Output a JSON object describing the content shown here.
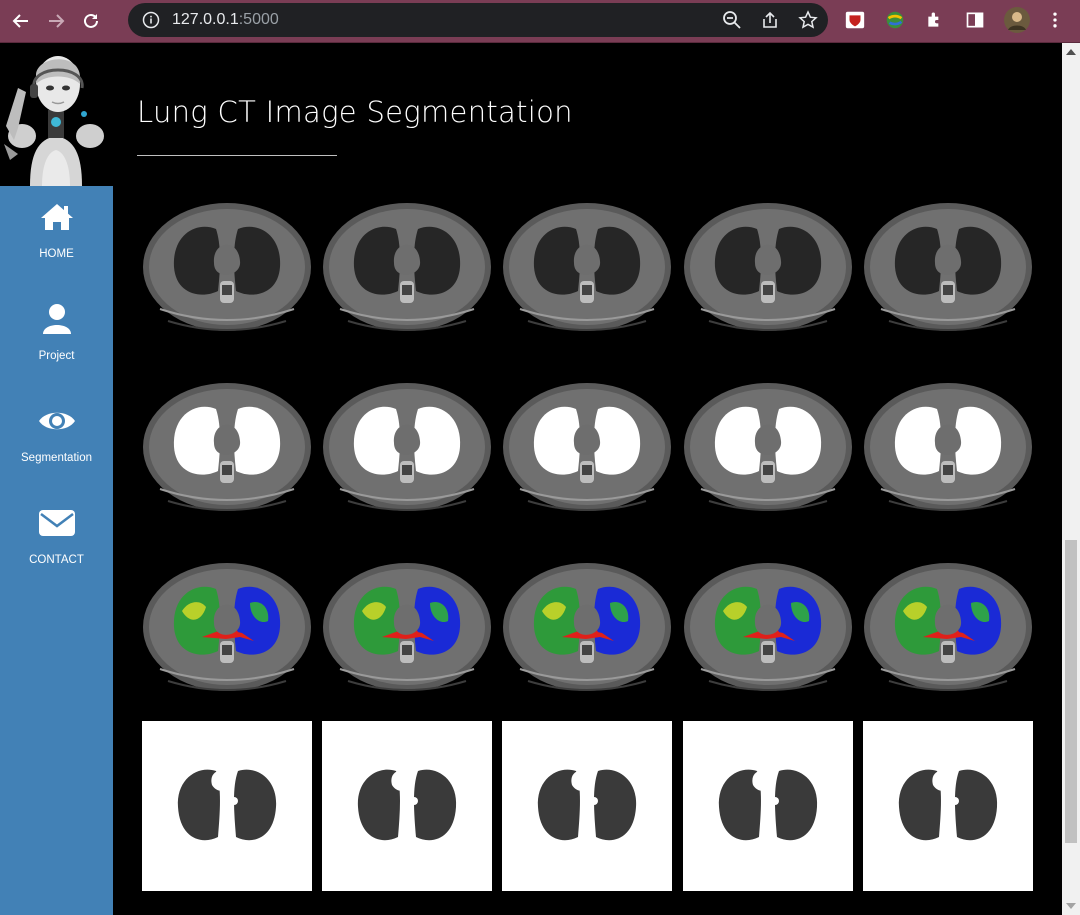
{
  "browser": {
    "url_host": "127.0.0.1",
    "url_port": ":5000"
  },
  "sidebar": {
    "items": [
      {
        "label": "HOME",
        "icon": "home-icon"
      },
      {
        "label": "Project",
        "icon": "user-icon"
      },
      {
        "label": "Segmentation",
        "icon": "eye-icon"
      },
      {
        "label": "CONTACT",
        "icon": "envelope-icon"
      }
    ]
  },
  "main": {
    "title": "Lung CT Image Segmentation"
  },
  "colors": {
    "sidebar_bg": "#4281b6",
    "page_bg": "#000000",
    "browser_frame": "#7a3d55"
  },
  "image_grid": {
    "rows": [
      "ct-scan",
      "lung-mask",
      "segmentation-overlay",
      "extracted-lung"
    ],
    "columns": 5
  }
}
